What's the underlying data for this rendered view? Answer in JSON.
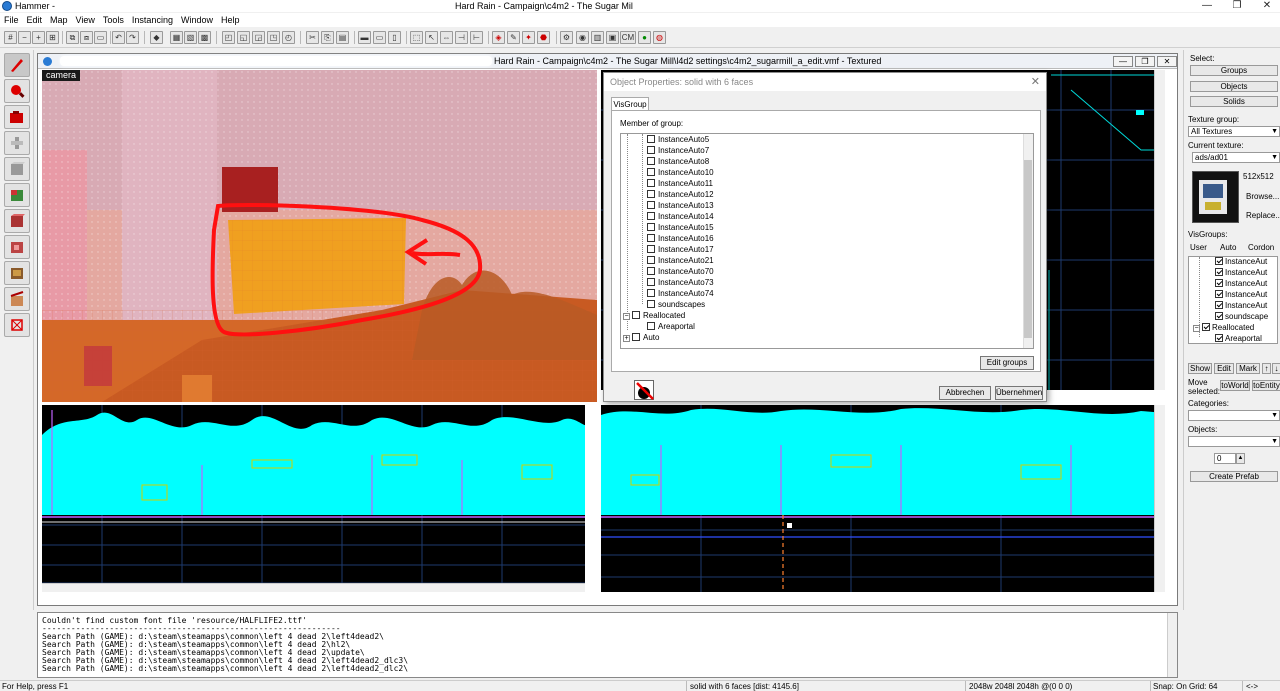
{
  "app": {
    "title": "Hammer -",
    "document_title": "Hard Rain - Campaign\\c4m2 - The Sugar Mil"
  },
  "window_controls": {
    "minimize": "—",
    "maximize": "❐",
    "close": "✕"
  },
  "menu": [
    "File",
    "Edit",
    "Map",
    "View",
    "Tools",
    "Instancing",
    "Window",
    "Help"
  ],
  "toolbar": {
    "cm_label": "CM"
  },
  "document": {
    "caption": "Hard Rain - Campaign\\c4m2 - The Sugar Mill\\l4d2 settings\\c4m2_sugarmill_a_edit.vmf - Textured",
    "camera_label": "camera"
  },
  "dialog": {
    "title": "Object Properties: solid with 6 faces",
    "tab": "VisGroup",
    "member_label": "Member of group:",
    "groups": [
      "InstanceAuto5",
      "InstanceAuto7",
      "InstanceAuto8",
      "InstanceAuto10",
      "InstanceAuto11",
      "InstanceAuto12",
      "InstanceAuto13",
      "InstanceAuto14",
      "InstanceAuto15",
      "InstanceAuto16",
      "InstanceAuto17",
      "InstanceAuto21",
      "InstanceAuto70",
      "InstanceAuto73",
      "InstanceAuto74",
      "soundscapes"
    ],
    "reallocated": "Reallocated",
    "areaportal": "Areaportal",
    "auto": "Auto",
    "edit_groups": "Edit groups",
    "cancel": "Abbrechen",
    "apply": "Übernehmen"
  },
  "right_panel": {
    "select_label": "Select:",
    "groups_btn": "Groups",
    "objects_btn": "Objects",
    "solids_btn": "Solids",
    "texture_group_label": "Texture group:",
    "texture_group_value": "All Textures",
    "current_texture_label": "Current texture:",
    "current_texture_value": "ads/ad01",
    "texture_size": "512x512",
    "browse_btn": "Browse...",
    "replace_btn": "Replace...",
    "visgroups_label": "VisGroups:",
    "tabs": [
      "User",
      "Auto",
      "Cordon"
    ],
    "vis_items": [
      "InstanceAut",
      "InstanceAut",
      "InstanceAut",
      "InstanceAut",
      "InstanceAut",
      "soundscape"
    ],
    "vis_reallocated": "Reallocated",
    "vis_areaportal": "Areaportal",
    "show_btn": "Show",
    "edit_btn": "Edit",
    "mark_btn": "Mark",
    "up_btn": "↑",
    "down_btn": "↓",
    "move_selected_label": "Move selected:",
    "to_world_btn": "toWorld",
    "to_entity_btn": "toEntity",
    "categories_label": "Categories:",
    "objects_label": "Objects:",
    "spin_value": "0",
    "create_prefab_btn": "Create Prefab"
  },
  "console": [
    "Couldn't find custom font file 'resource/HALFLIFE2.ttf'",
    "--------------------------------------------------------------",
    "Search Path (GAME): d:\\steam\\steamapps\\common\\left 4 dead 2\\left4dead2\\",
    "Search Path (GAME): d:\\steam\\steamapps\\common\\left 4 dead 2\\hl2\\",
    "Search Path (GAME): d:\\steam\\steamapps\\common\\left 4 dead 2\\update\\",
    "Search Path (GAME): d:\\steam\\steamapps\\common\\left 4 dead 2\\left4dead2_dlc3\\",
    "Search Path (GAME): d:\\steam\\steamapps\\common\\left 4 dead 2\\left4dead2_dlc2\\"
  ],
  "status": {
    "help": "For Help, press F1",
    "selection": "solid with 6 faces  [dist: 4145.6]",
    "size": "2048w 2048l 2048h @(0 0 0)",
    "snap": "Snap: On Grid: 64",
    "arrows": "<->"
  },
  "colors": {
    "annotation_red": "#ff1010",
    "selection_orange": "#f0a020",
    "wireframe_cyan": "#00ffff"
  }
}
